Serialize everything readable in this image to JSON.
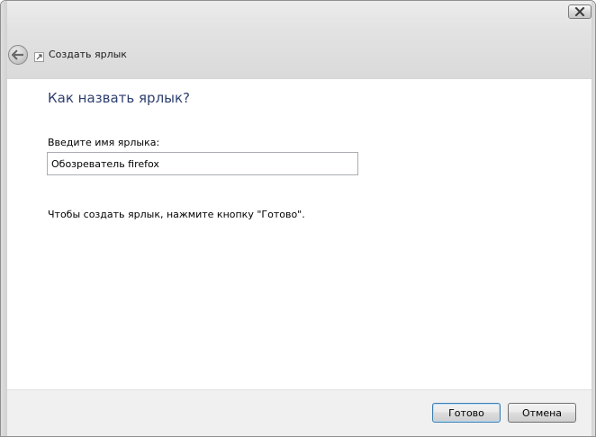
{
  "window": {
    "close_icon": "close-icon"
  },
  "header": {
    "title": "Создать ярлык",
    "back_icon": "back-arrow-icon",
    "app_icon": "shortcut-icon"
  },
  "main": {
    "instruction": "Как назвать ярлык?",
    "field_label": "Введите имя ярлыка:",
    "name_value": "Обозреватель firefox",
    "hint": "Чтобы создать ярлык, нажмите кнопку \"Готово\"."
  },
  "footer": {
    "finish_label": "Готово",
    "cancel_label": "Отмена"
  },
  "colors": {
    "accent": "#2e3f6f",
    "frame": "#dadada",
    "footer_bg": "#f0f0f0"
  }
}
